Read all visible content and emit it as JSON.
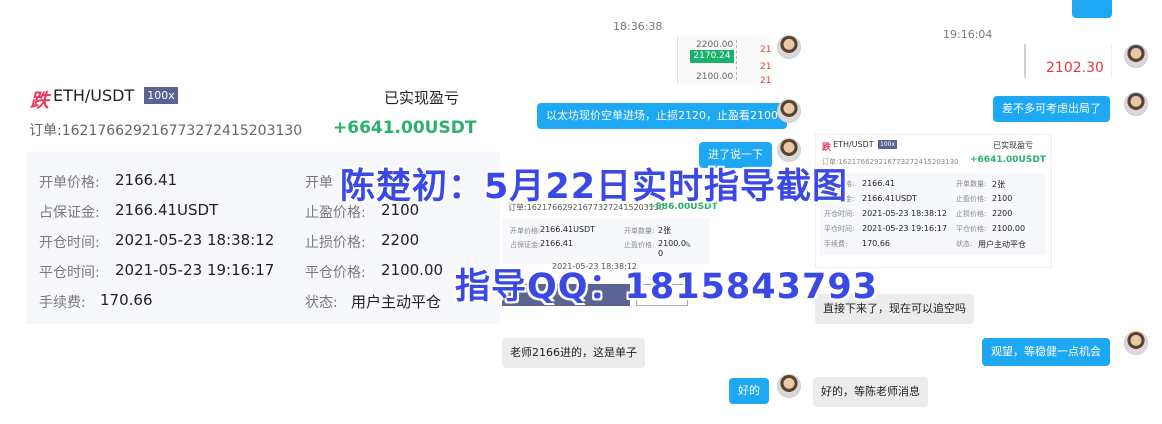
{
  "trade_card": {
    "direction_tag": "跌",
    "pair": "ETH/USDT",
    "leverage": "100x",
    "realized_label": "已实现盈亏",
    "order_label": "订单:",
    "order_id": "1621766292167732 7241520313 0",
    "order_text": "订单:162176629216773272415203130",
    "pnl": "+6641.00USDT",
    "rows": [
      {
        "label": "开单价格:",
        "value": "2166.41",
        "label2": "开单"
      },
      {
        "label": "占保证金:",
        "value": "2166.41USDT",
        "label2": "止盈价格:",
        "value2": "2100"
      },
      {
        "label": "开仓时间:",
        "value": "2021-05-23 18:38:12",
        "label2": "止损价格:",
        "value2": "2200"
      },
      {
        "label": "平仓时间:",
        "value": "2021-05-23 19:16:17",
        "label2": "平仓价格:",
        "value2": "2100.00"
      },
      {
        "label": "手续费:",
        "value": "170.66",
        "label2": "状态:",
        "value2": "用户主动平仓"
      }
    ]
  },
  "chat": {
    "timestamps": [
      "18:36:38",
      "19:16:04"
    ],
    "mini_chart": {
      "price_high": "2200.00",
      "price_cur": "2170.24",
      "price_low": "2100.00",
      "ticks": [
        "21",
        "21",
        "21"
      ]
    },
    "price_snapshot": "2102.30",
    "messages": {
      "m1": "以太坊现价空单进场，止损2120，止盈看2100",
      "m2": "进了说一下",
      "m3": "差不多可考虑出局了",
      "m4": "直接下来了，现在可以追空吗",
      "m5": "老师2166进的，这是单子",
      "m6": "观望，等稳健一点机会",
      "m7": "好的",
      "m8": "好的，等陈老师消息"
    },
    "partial_card": {
      "order": "订单:162176629216773272415203130",
      "pnl": "+586.00USDT",
      "r1_lbl": "开单价格:",
      "r1_val": "2166.41USDT",
      "r1_lbl2": "开单数量:",
      "r1_val2": "2张",
      "r2_lbl": "占保证金:",
      "r2_val": "2166.41",
      "r2_lbl2": "止盈价格:",
      "r2_val2": "2100.0",
      "r2_val2b": "0",
      "r3": "2021-05-23 18:38:12",
      "btn1": "平仓",
      "btn2": "分享"
    },
    "small_card": {
      "pair": "ETH/USDT",
      "leverage": "100x",
      "realized_label": "已实现盈亏",
      "order": "订单:162176629216773272415203130",
      "pnl": "+6641.00USDT",
      "rows": [
        {
          "l": "开单价格:",
          "v": "2166.41",
          "l2": "开单数量:",
          "v2": "2张"
        },
        {
          "l": "占保证金:",
          "v": "2166.41USDT",
          "l2": "止盈价格:",
          "v2": "2100"
        },
        {
          "l": "开仓时间:",
          "v": "2021-05-23 18:38:12",
          "l2": "止损价格:",
          "v2": "2200"
        },
        {
          "l": "平仓时间:",
          "v": "2021-05-23 19:16:17",
          "l2": "平仓价格:",
          "v2": "2100.00"
        },
        {
          "l": "手续费:",
          "v": "170.66",
          "l2": "状态:",
          "v2": "用户主动平仓"
        }
      ]
    }
  },
  "watermark": {
    "line1": "陈楚初：5月22日实时指导截图",
    "line2": "指导QQ：1815843793"
  },
  "colors": {
    "accent_blue": "#1ea7f3",
    "profit_green": "#2ab26a",
    "loss_red": "#e23b3b",
    "watermark_blue": "#3a48e6"
  }
}
